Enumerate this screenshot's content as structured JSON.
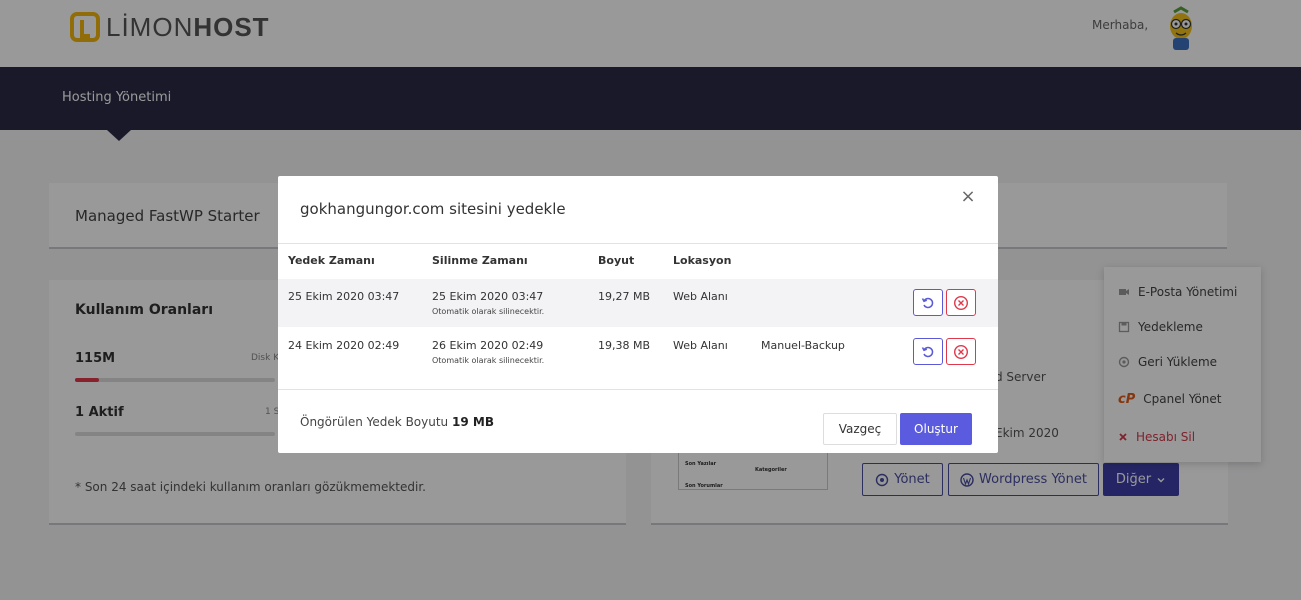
{
  "brand": {
    "name_light": "LİMON",
    "name_bold": "HOST"
  },
  "header": {
    "greeting": "Merhaba,"
  },
  "nav": {
    "active_item": "Hosting Yönetimi"
  },
  "product": {
    "name": "Managed FastWP Starter"
  },
  "usage": {
    "title": "Kullanım Oranları",
    "disk_value": "115M",
    "disk_label": "Disk K",
    "disk_fill": 0.12,
    "active_value": "1 Aktif",
    "active_label": "1 S",
    "note": "* Son 24 saat içindeki kullanım oranları gözükmemektedir."
  },
  "site_card": {
    "server_text": "d Server",
    "date_text": "Ekim 2020",
    "thumbnail": {
      "label1": "Son Yazılar",
      "label2": "Kategoriler",
      "label3": "Son Yorumlar"
    },
    "buttons": {
      "manage": "Yönet",
      "wordpress": "Wordpress Yönet",
      "other": "Diğer"
    }
  },
  "dropdown": {
    "items": [
      {
        "label": "E-Posta Yönetimi",
        "icon": "mail-icon"
      },
      {
        "label": "Yedekleme",
        "icon": "save-icon"
      },
      {
        "label": "Geri Yükleme",
        "icon": "restore-icon"
      },
      {
        "label": "Cpanel Yönet",
        "icon": "cpanel-icon"
      },
      {
        "label": "Hesabı Sil",
        "icon": "x-icon"
      }
    ]
  },
  "modal": {
    "title": "gokhangungor.com sitesini yedekle",
    "columns": {
      "backup_time": "Yedek Zamanı",
      "delete_time": "Silinme Zamanı",
      "size": "Boyut",
      "location": "Lokasyon"
    },
    "rows": [
      {
        "backup_time": "25 Ekim 2020 03:47",
        "delete_time": "25 Ekim 2020 03:47",
        "delete_note": "Otomatik olarak silinecektir.",
        "size": "19,27 MB",
        "location": "Web Alanı",
        "tag": ""
      },
      {
        "backup_time": "24 Ekim 2020 02:49",
        "delete_time": "26 Ekim 2020 02:49",
        "delete_note": "Otomatik olarak silinecektir.",
        "size": "19,38 MB",
        "location": "Web Alanı",
        "tag": "Manuel-Backup"
      }
    ],
    "estimate_label": "Öngörülen Yedek Boyutu",
    "estimate_value": "19 MB",
    "cancel_label": "Vazgeç",
    "create_label": "Oluştur"
  },
  "colors": {
    "accent": "#5b5be0",
    "danger": "#e0384b",
    "nav_bg": "#2c2b47",
    "logo": "#f2b611"
  }
}
